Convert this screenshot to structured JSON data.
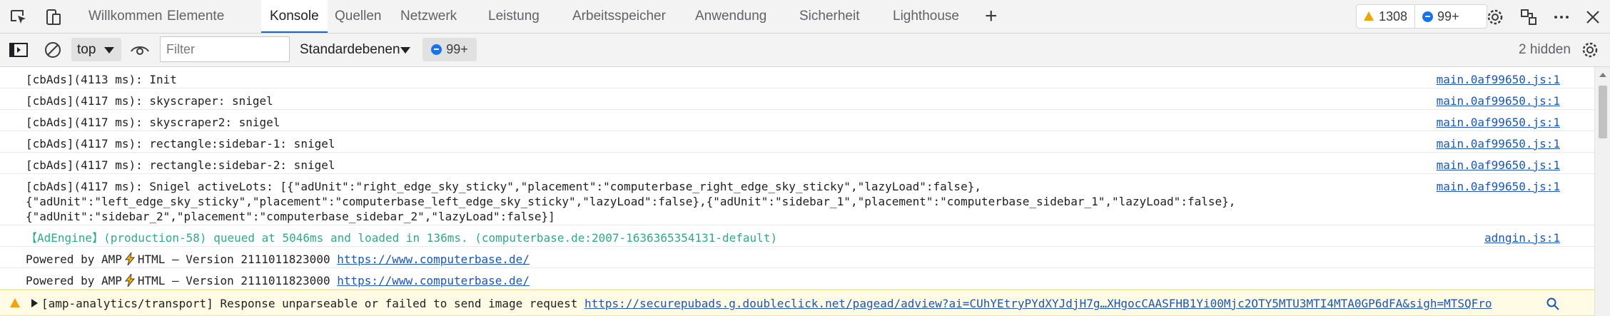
{
  "tabs": [
    "Willkommen",
    "Elemente",
    "Konsole",
    "Quellen",
    "Netzwerk",
    "Leistung",
    "Arbeitsspeicher",
    "Anwendung",
    "Sicherheit",
    "Lighthouse"
  ],
  "active_tab": "Konsole",
  "header_counts": {
    "warnings": "1308",
    "messages": "99+"
  },
  "toolbar": {
    "context": "top",
    "filter_placeholder": "Filter",
    "levels": "Standardebenen",
    "message_count": "99+",
    "hidden": "2 hidden"
  },
  "colors": {
    "accent": "#0b6bd3",
    "warning": "#f0a30a",
    "info": "#1a73e8",
    "link": "#1a57b8",
    "adengine": "#2ea98a"
  },
  "icons": [
    "inspect-icon",
    "device-emulation-icon",
    "plus-icon",
    "gear-icon",
    "connect-icon",
    "more-icon",
    "close-icon",
    "sidebar-icon",
    "clear-icon",
    "eye-icon",
    "bolt-icon",
    "search-icon"
  ],
  "messages": [
    {
      "text": "[cbAds](4113 ms): Init",
      "source": "main.0af99650.js:1"
    },
    {
      "text": "[cbAds](4117 ms): skyscraper: snigel",
      "source": "main.0af99650.js:1"
    },
    {
      "text": "[cbAds](4117 ms): skyscraper2: snigel",
      "source": "main.0af99650.js:1"
    },
    {
      "text": "[cbAds](4117 ms): rectangle:sidebar-1: snigel",
      "source": "main.0af99650.js:1"
    },
    {
      "text": "[cbAds](4117 ms): rectangle:sidebar-2: snigel",
      "source": "main.0af99650.js:1"
    },
    {
      "lines": [
        "[cbAds](4117 ms): Snigel activeLots: [{\"adUnit\":\"right_edge_sky_sticky\",\"placement\":\"computerbase_right_edge_sky_sticky\",\"lazyLoad\":false},",
        "{\"adUnit\":\"left_edge_sky_sticky\",\"placement\":\"computerbase_left_edge_sky_sticky\",\"lazyLoad\":false},{\"adUnit\":\"sidebar_1\",\"placement\":\"computerbase_sidebar_1\",\"lazyLoad\":false},",
        "{\"adUnit\":\"sidebar_2\",\"placement\":\"computerbase_sidebar_2\",\"lazyLoad\":false}]"
      ],
      "source": "main.0af99650.js:1"
    },
    {
      "text": "【AdEngine】(production-58) queued at 5046ms and loaded in 136ms. (computerbase.de:2007-1636365354131-default)",
      "source": "adngin.js:1"
    },
    {
      "prefix": "Powered by AMP",
      "suffix": "HTML – Version 2111011823000",
      "url": "https://www.computerbase.de/"
    },
    {
      "prefix": "Powered by AMP",
      "suffix": "HTML – Version 2111011823000",
      "url": "https://www.computerbase.de/"
    },
    {
      "text": "[amp-analytics/transport] Response unparseable or failed to send image request",
      "url": "https://securepubads.g.doubleclick.net/pagead/adview?ai=CUhYEtryPYdXYJdjH7g…XHgocCAASFHB1Yi00Mjc2OTY5MTU3MTI4MTA0GP6dFA&sigh=MTSQFro"
    }
  ]
}
